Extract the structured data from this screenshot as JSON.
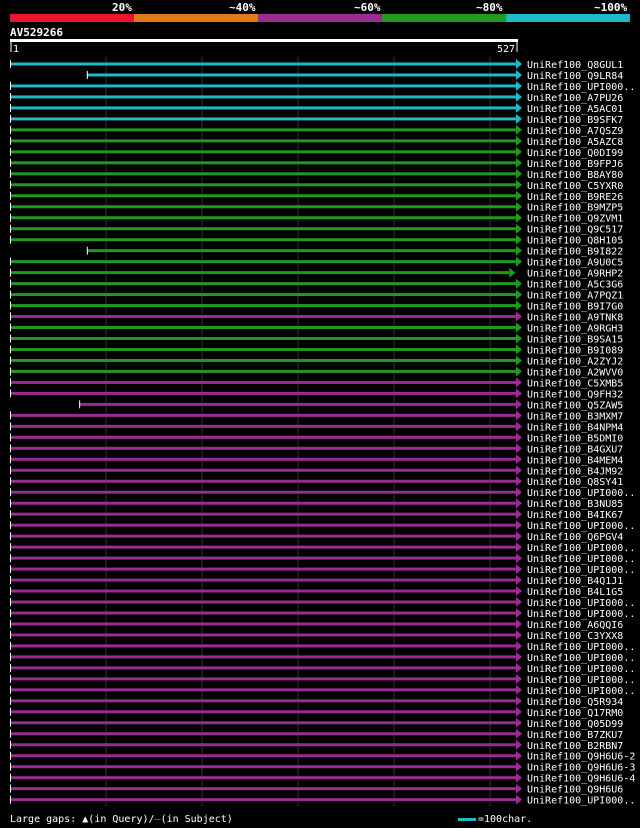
{
  "legend": {
    "labels": [
      "20%",
      "~40%",
      "~60%",
      "~80%",
      "~100%"
    ],
    "colors": [
      "#e8152c",
      "#e07a17",
      "#9b2a93",
      "#1f9a1f",
      "#1fb9c9"
    ]
  },
  "query": {
    "name": "AV529266",
    "start": "1",
    "end": "527",
    "length": 527
  },
  "hits": [
    {
      "id": "UniRef100_Q8GUL1",
      "c": 4,
      "s": 0,
      "e": 527
    },
    {
      "id": "UniRef100_Q9LR84",
      "c": 4,
      "s": 80,
      "e": 527
    },
    {
      "id": "UniRef100_UPI000..",
      "c": 4,
      "s": 0,
      "e": 527
    },
    {
      "id": "UniRef100_A7PU26",
      "c": 4,
      "s": 0,
      "e": 527
    },
    {
      "id": "UniRef100_A5AC01",
      "c": 4,
      "s": 0,
      "e": 527
    },
    {
      "id": "UniRef100_B9SFK7",
      "c": 4,
      "s": 0,
      "e": 527
    },
    {
      "id": "UniRef100_A7QSZ9",
      "c": 3,
      "s": 0,
      "e": 527
    },
    {
      "id": "UniRef100_A5AZC8",
      "c": 3,
      "s": 0,
      "e": 527
    },
    {
      "id": "UniRef100_Q0DI99",
      "c": 3,
      "s": 0,
      "e": 527
    },
    {
      "id": "UniRef100_B9FPJ6",
      "c": 3,
      "s": 0,
      "e": 527
    },
    {
      "id": "UniRef100_B8AY80",
      "c": 3,
      "s": 0,
      "e": 527
    },
    {
      "id": "UniRef100_C5YXR0",
      "c": 3,
      "s": 0,
      "e": 527
    },
    {
      "id": "UniRef100_B9RE26",
      "c": 3,
      "s": 0,
      "e": 527
    },
    {
      "id": "UniRef100_B9MZP5",
      "c": 3,
      "s": 0,
      "e": 527
    },
    {
      "id": "UniRef100_Q9ZVM1",
      "c": 3,
      "s": 0,
      "e": 527
    },
    {
      "id": "UniRef100_Q9C517",
      "c": 3,
      "s": 0,
      "e": 527
    },
    {
      "id": "UniRef100_Q8H105",
      "c": 3,
      "s": 0,
      "e": 527
    },
    {
      "id": "UniRef100_B9I822",
      "c": 3,
      "s": 80,
      "e": 527
    },
    {
      "id": "UniRef100_A9U0C5",
      "c": 3,
      "s": 0,
      "e": 527
    },
    {
      "id": "UniRef100_A9RHP2",
      "c": 3,
      "s": 0,
      "e": 520
    },
    {
      "id": "UniRef100_A5C3G6",
      "c": 3,
      "s": 0,
      "e": 527
    },
    {
      "id": "UniRef100_A7PQZ1",
      "c": 3,
      "s": 0,
      "e": 527
    },
    {
      "id": "UniRef100_B9I7G0",
      "c": 3,
      "s": 0,
      "e": 527
    },
    {
      "id": "UniRef100_A9TNK8",
      "c": 2,
      "s": 0,
      "e": 527
    },
    {
      "id": "UniRef100_A9RGH3",
      "c": 3,
      "s": 0,
      "e": 527
    },
    {
      "id": "UniRef100_B9SA15",
      "c": 3,
      "s": 0,
      "e": 527
    },
    {
      "id": "UniRef100_B9I089",
      "c": 3,
      "s": 0,
      "e": 527
    },
    {
      "id": "UniRef100_A2ZYJ2",
      "c": 3,
      "s": 0,
      "e": 527
    },
    {
      "id": "UniRef100_A2WVV0",
      "c": 3,
      "s": 0,
      "e": 527
    },
    {
      "id": "UniRef100_C5XMB5",
      "c": 2,
      "s": 0,
      "e": 527
    },
    {
      "id": "UniRef100_Q9FH32",
      "c": 2,
      "s": 0,
      "e": 527
    },
    {
      "id": "UniRef100_Q5ZAW5",
      "c": 2,
      "s": 72,
      "e": 527
    },
    {
      "id": "UniRef100_B3MXM7",
      "c": 2,
      "s": 0,
      "e": 527
    },
    {
      "id": "UniRef100_B4NPM4",
      "c": 2,
      "s": 0,
      "e": 527
    },
    {
      "id": "UniRef100_B5DMI0",
      "c": 2,
      "s": 0,
      "e": 527
    },
    {
      "id": "UniRef100_B4GXU7",
      "c": 2,
      "s": 0,
      "e": 527
    },
    {
      "id": "UniRef100_B4MEM4",
      "c": 2,
      "s": 0,
      "e": 527
    },
    {
      "id": "UniRef100_B4JM92",
      "c": 2,
      "s": 0,
      "e": 527
    },
    {
      "id": "UniRef100_Q8SY41",
      "c": 2,
      "s": 0,
      "e": 527
    },
    {
      "id": "UniRef100_UPI000..",
      "c": 2,
      "s": 0,
      "e": 527
    },
    {
      "id": "UniRef100_B3NU85",
      "c": 2,
      "s": 0,
      "e": 527
    },
    {
      "id": "UniRef100_B4IK67",
      "c": 2,
      "s": 0,
      "e": 527
    },
    {
      "id": "UniRef100_UPI000..",
      "c": 2,
      "s": 0,
      "e": 527
    },
    {
      "id": "UniRef100_Q6PGV4",
      "c": 2,
      "s": 0,
      "e": 527
    },
    {
      "id": "UniRef100_UPI000..",
      "c": 2,
      "s": 0,
      "e": 527
    },
    {
      "id": "UniRef100_UPI000..",
      "c": 2,
      "s": 0,
      "e": 527
    },
    {
      "id": "UniRef100_UPI000..",
      "c": 2,
      "s": 0,
      "e": 527
    },
    {
      "id": "UniRef100_B4Q1J1",
      "c": 2,
      "s": 0,
      "e": 527
    },
    {
      "id": "UniRef100_B4L1G5",
      "c": 2,
      "s": 0,
      "e": 527
    },
    {
      "id": "UniRef100_UPI000..",
      "c": 2,
      "s": 0,
      "e": 527
    },
    {
      "id": "UniRef100_UPI000..",
      "c": 2,
      "s": 0,
      "e": 527
    },
    {
      "id": "UniRef100_A6QQI6",
      "c": 2,
      "s": 0,
      "e": 527
    },
    {
      "id": "UniRef100_C3YXX8",
      "c": 2,
      "s": 0,
      "e": 527
    },
    {
      "id": "UniRef100_UPI000..",
      "c": 2,
      "s": 0,
      "e": 527
    },
    {
      "id": "UniRef100_UPI000..",
      "c": 2,
      "s": 0,
      "e": 527
    },
    {
      "id": "UniRef100_UPI000..",
      "c": 2,
      "s": 0,
      "e": 527
    },
    {
      "id": "UniRef100_UPI000..",
      "c": 2,
      "s": 0,
      "e": 527
    },
    {
      "id": "UniRef100_UPI000..",
      "c": 2,
      "s": 0,
      "e": 527
    },
    {
      "id": "UniRef100_Q5R934",
      "c": 2,
      "s": 0,
      "e": 527
    },
    {
      "id": "UniRef100_Q17RM0",
      "c": 2,
      "s": 0,
      "e": 527
    },
    {
      "id": "UniRef100_Q05D99",
      "c": 2,
      "s": 0,
      "e": 527
    },
    {
      "id": "UniRef100_B7ZKU7",
      "c": 2,
      "s": 0,
      "e": 527
    },
    {
      "id": "UniRef100_B2RBN7",
      "c": 2,
      "s": 0,
      "e": 527
    },
    {
      "id": "UniRef100_Q9H6U6-2",
      "c": 2,
      "s": 0,
      "e": 527
    },
    {
      "id": "UniRef100_Q9H6U6-3",
      "c": 2,
      "s": 0,
      "e": 527
    },
    {
      "id": "UniRef100_Q9H6U6-4",
      "c": 2,
      "s": 0,
      "e": 527
    },
    {
      "id": "UniRef100_Q9H6U6",
      "c": 2,
      "s": 0,
      "e": 527
    },
    {
      "id": "UniRef100_UPI000..",
      "c": 2,
      "s": 0,
      "e": 527
    }
  ],
  "footer": {
    "gaps_label": "Large gaps:",
    "query_gap": "(in Query)/",
    "subject_gap": "(in Subject)",
    "scale_label": "=100char."
  }
}
